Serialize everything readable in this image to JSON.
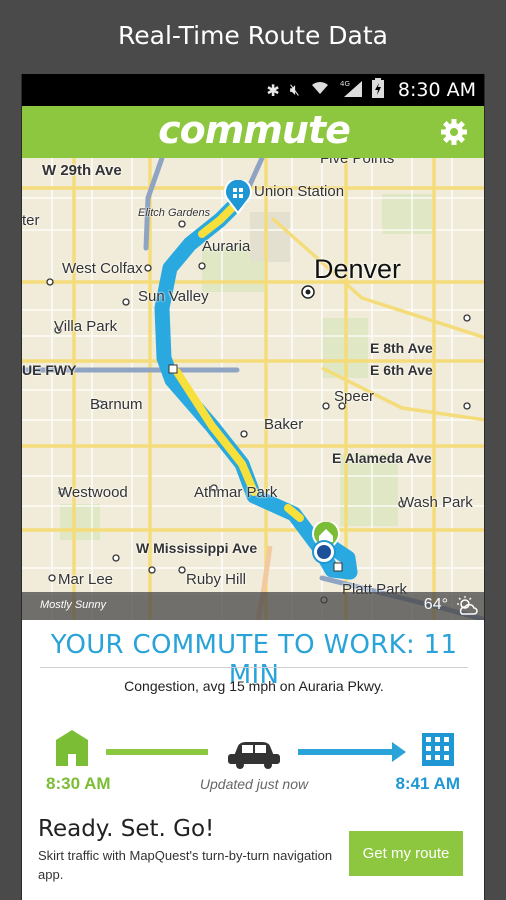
{
  "banner": {
    "title": "Real-Time Route Data"
  },
  "statusbar": {
    "time": "8:30 AM",
    "network": "4G"
  },
  "app": {
    "name": "commute"
  },
  "map": {
    "labels": {
      "w29th": "W 29th Ave",
      "fivepoints": "Five Points",
      "union": "Union Station",
      "elitch": "Elitch Gardens",
      "auraria": "Auraria",
      "ter": "ter",
      "westcolfax": "West Colfax",
      "denver": "Denver",
      "sunvalley": "Sun Valley",
      "villapark": "Villa Park",
      "e8th": "E 8th Ave",
      "uefwy": "UE FWY",
      "e6th": "E 6th Ave",
      "barnum": "Barnum",
      "speer": "Speer",
      "baker": "Baker",
      "ealameda": "E Alameda Ave",
      "westwood": "Westwood",
      "athmar": "Athmar Park",
      "washpark": "Wash Park",
      "wmiss": "W Mississippi Ave",
      "marlee": "Mar Lee",
      "rubyhill": "Ruby Hill",
      "platt": "Platt Park"
    }
  },
  "weather": {
    "condition": "Mostly Sunny",
    "temp": "64°"
  },
  "commute": {
    "title": "YOUR COMMUTE TO WORK: 11 MIN",
    "congestion": "Congestion, avg 15 mph on Auraria Pkwy.",
    "home_time": "8:30 AM",
    "updated": "Updated just now",
    "work_time": "8:41 AM"
  },
  "promo": {
    "heading": "Ready. Set. Go!",
    "body": "Skirt traffic with MapQuest's turn-by-turn navigation app.",
    "button": "Get my route"
  },
  "colors": {
    "brand_green": "#8dc63f",
    "accent_blue": "#29a3d8",
    "traffic_yellow": "#f7e03c",
    "route_blue": "#2aa9e0"
  }
}
